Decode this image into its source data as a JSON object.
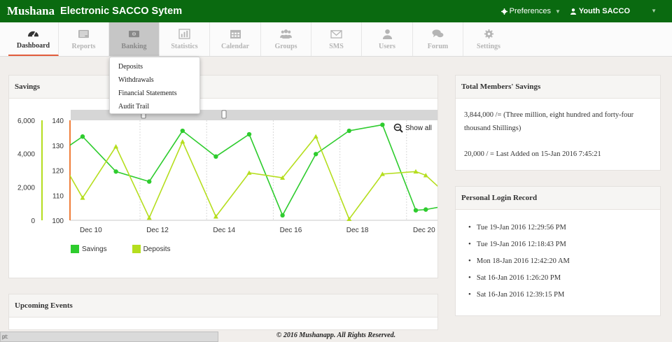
{
  "header": {
    "brand": "Mushana",
    "title": "Electronic SACCO Sytem",
    "preferences_label": "Preferences",
    "user_label": "Youth SACCO"
  },
  "nav": {
    "items": [
      {
        "label": "Dashboard",
        "icon": "dashboard-icon"
      },
      {
        "label": "Reports",
        "icon": "reports-icon"
      },
      {
        "label": "Banking",
        "icon": "banking-icon"
      },
      {
        "label": "Statistics",
        "icon": "statistics-icon"
      },
      {
        "label": "Calendar",
        "icon": "calendar-icon"
      },
      {
        "label": "Groups",
        "icon": "groups-icon"
      },
      {
        "label": "SMS",
        "icon": "envelope-icon"
      },
      {
        "label": "Users",
        "icon": "user-icon"
      },
      {
        "label": "Forum",
        "icon": "forum-icon"
      },
      {
        "label": "Settings",
        "icon": "gear-icon"
      }
    ],
    "active": "Dashboard",
    "open": "Banking"
  },
  "banking_menu": {
    "items": [
      "Deposits",
      "Withdrawals",
      "Financial Statements",
      "Audit Trail"
    ]
  },
  "savings_panel": {
    "title": "Savings"
  },
  "chart_data": {
    "type": "line",
    "x_tick_labels": [
      "Dec 10",
      "Dec 12",
      "Dec 14",
      "Dec 16",
      "Dec 18",
      "Dec 20"
    ],
    "x": [
      9.4,
      10,
      11,
      12,
      13,
      14,
      15,
      16,
      17,
      18,
      19,
      20,
      20.3,
      21
    ],
    "left_axis": {
      "ticks": [
        "0",
        "2,000",
        "4,000",
        "6,000"
      ],
      "range": [
        0,
        6000
      ]
    },
    "right_axis": {
      "ticks": [
        100,
        110,
        120,
        130,
        140
      ],
      "range": [
        100,
        140
      ]
    },
    "series": [
      {
        "name": "Savings",
        "color": "#2ecc2e",
        "axis": "right",
        "values": [
          128,
          133.5,
          119.5,
          115.5,
          135.8,
          125.5,
          134.4,
          102,
          126.5,
          135.8,
          138.2,
          104,
          104.3,
          106
        ]
      },
      {
        "name": "Deposits",
        "color": "#b5de1e",
        "axis": "right",
        "values": [
          123,
          109,
          129.5,
          101,
          131.5,
          101.5,
          119,
          117,
          133.5,
          100.5,
          118.5,
          119.5,
          118,
          109.5
        ]
      }
    ],
    "zoom_label": "Show all",
    "legend_position": "bottom-left"
  },
  "events_panel": {
    "title": "Upcoming Events"
  },
  "total_savings": {
    "title": "Total Members' Savings",
    "amount_line": "3,844,000 /=   (Three million, eight hundred and forty-four thousand Shillings)",
    "last_added": "20,000 / =    Last Added on 15-Jan 2016 7:45:21"
  },
  "login_record": {
    "title": "Personal Login Record",
    "entries": [
      "Tue 19-Jan 2016 12:29:56 PM",
      "Tue 19-Jan 2016 12:18:43 PM",
      "Mon 18-Jan 2016 12:42:20 AM",
      "Sat 16-Jan 2016 1:26:20 PM",
      "Sat 16-Jan 2016 12:39:15 PM"
    ]
  },
  "footer": {
    "text": "© 2016 Mushanapp.    All Rights Reserved."
  },
  "statusbar": {
    "text": "pt:"
  }
}
